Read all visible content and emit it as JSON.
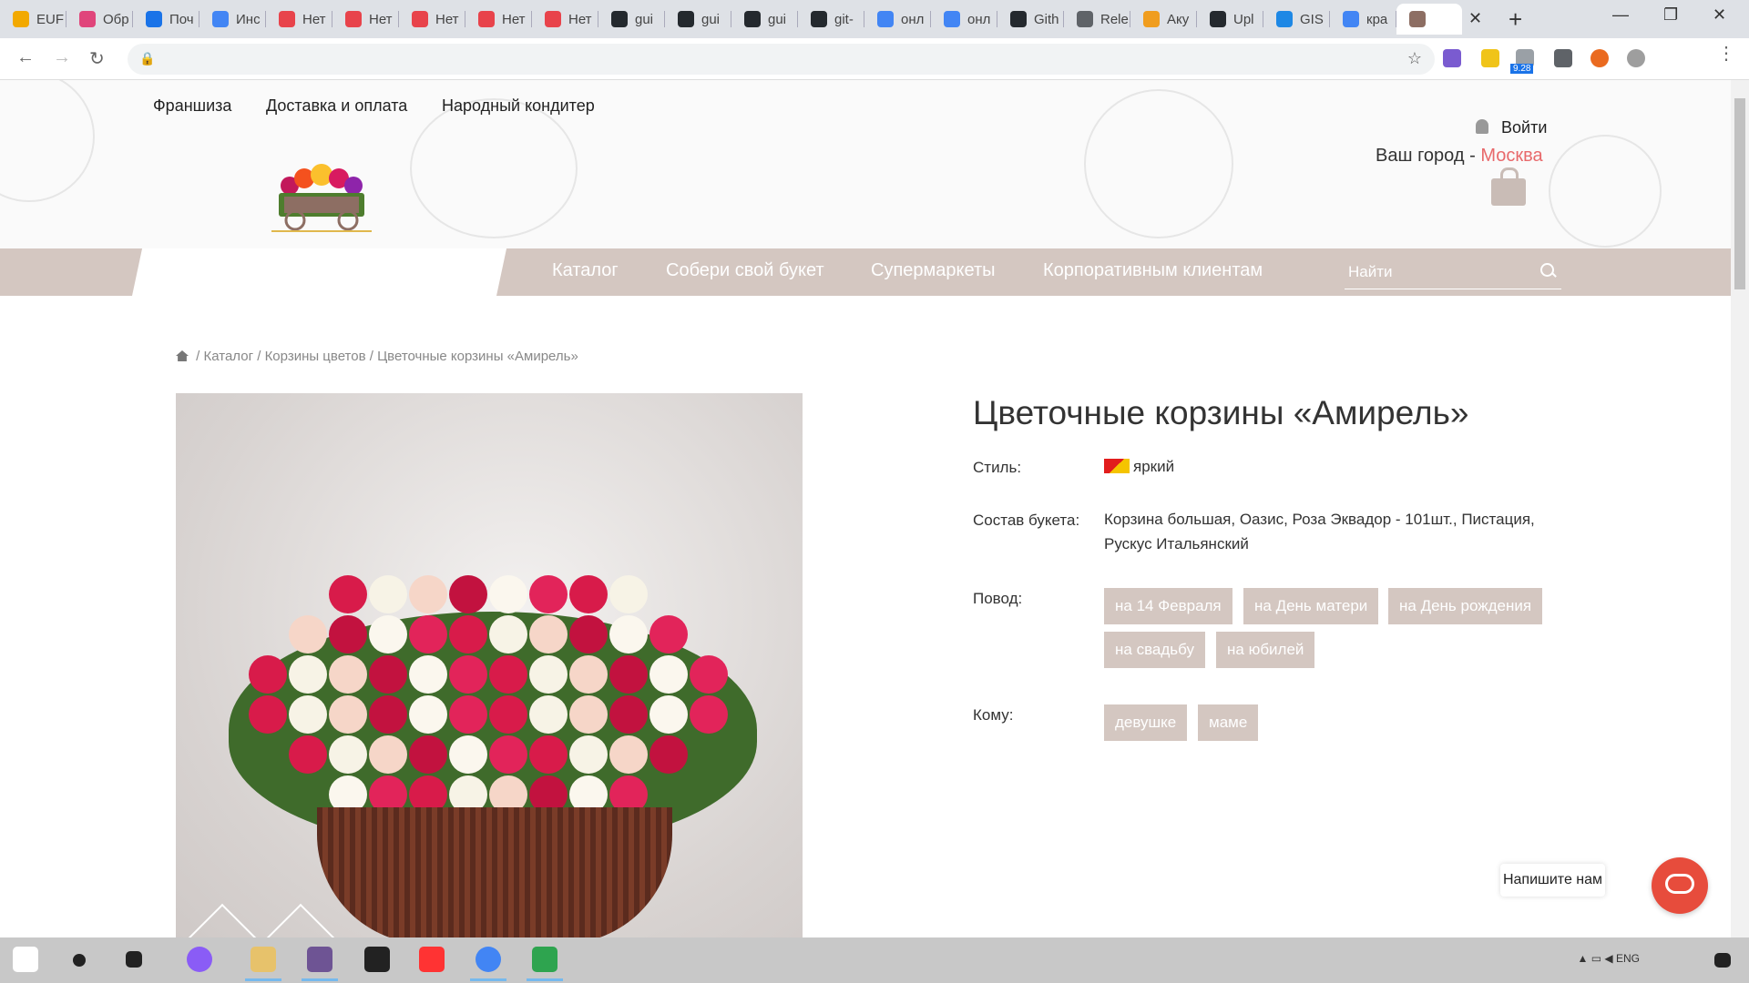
{
  "tabs": [
    {
      "label": "EUF",
      "color": "#f2a900"
    },
    {
      "label": "Обр",
      "color": "#e0457b"
    },
    {
      "label": "Поч",
      "color": "#1a73e8"
    },
    {
      "label": "Инс",
      "color": "#4285f4"
    },
    {
      "label": "Нет",
      "color": "#e8434b"
    },
    {
      "label": "Нет",
      "color": "#e8434b"
    },
    {
      "label": "Нет",
      "color": "#e8434b"
    },
    {
      "label": "Нет",
      "color": "#e8434b"
    },
    {
      "label": "Нет",
      "color": "#e8434b"
    },
    {
      "label": "gui",
      "color": "#24292e"
    },
    {
      "label": "gui",
      "color": "#24292e"
    },
    {
      "label": "gui",
      "color": "#24292e"
    },
    {
      "label": "git-",
      "color": "#24292e"
    },
    {
      "label": "онл",
      "color": "#4285f4"
    },
    {
      "label": "онл",
      "color": "#4285f4"
    },
    {
      "label": "Gith",
      "color": "#24292e"
    },
    {
      "label": "Rele",
      "color": "#5f6368"
    },
    {
      "label": "Аку",
      "color": "#f09d1e"
    },
    {
      "label": "Upl",
      "color": "#24292e"
    },
    {
      "label": "GIS",
      "color": "#1e88e5"
    },
    {
      "label": "кра",
      "color": "#4285f4"
    }
  ],
  "extensions_badge": "9.28",
  "site": {
    "top_links": [
      "Франшиза",
      "Доставка и оплата",
      "Народный кондитер"
    ],
    "login": "Войти",
    "city_label": "Ваш город -",
    "city": "Москва",
    "menu": [
      "Каталог",
      "Собери свой букет",
      "Супермаркеты",
      "Корпоративным клиентам"
    ],
    "search_placeholder": "Найти"
  },
  "breadcrumb": {
    "items": [
      "Каталог",
      "Корзины цветов",
      "Цветочные корзины «Амирель»"
    ],
    "separator": "/"
  },
  "product": {
    "title": "Цветочные корзины «Амирель»",
    "style_label": "Стиль:",
    "style_value": "яркий",
    "composition_label": "Состав букета:",
    "composition_value": "Корзина большая, Оазис, Роза Эквадор - 101шт., Пистация, Рускус Итальянский",
    "occasion_label": "Повод:",
    "occasions": [
      "на 14 Февраля",
      "на День матери",
      "на День рождения",
      "на свадьбу",
      "на юбилей"
    ],
    "recipient_label": "Кому:",
    "recipients": [
      "девушке",
      "маме"
    ]
  },
  "chat": {
    "label": "Напишите нам"
  },
  "colors": {
    "accent": "#d4c7c1",
    "city": "#e8696b",
    "chat": "#e74c3c"
  }
}
